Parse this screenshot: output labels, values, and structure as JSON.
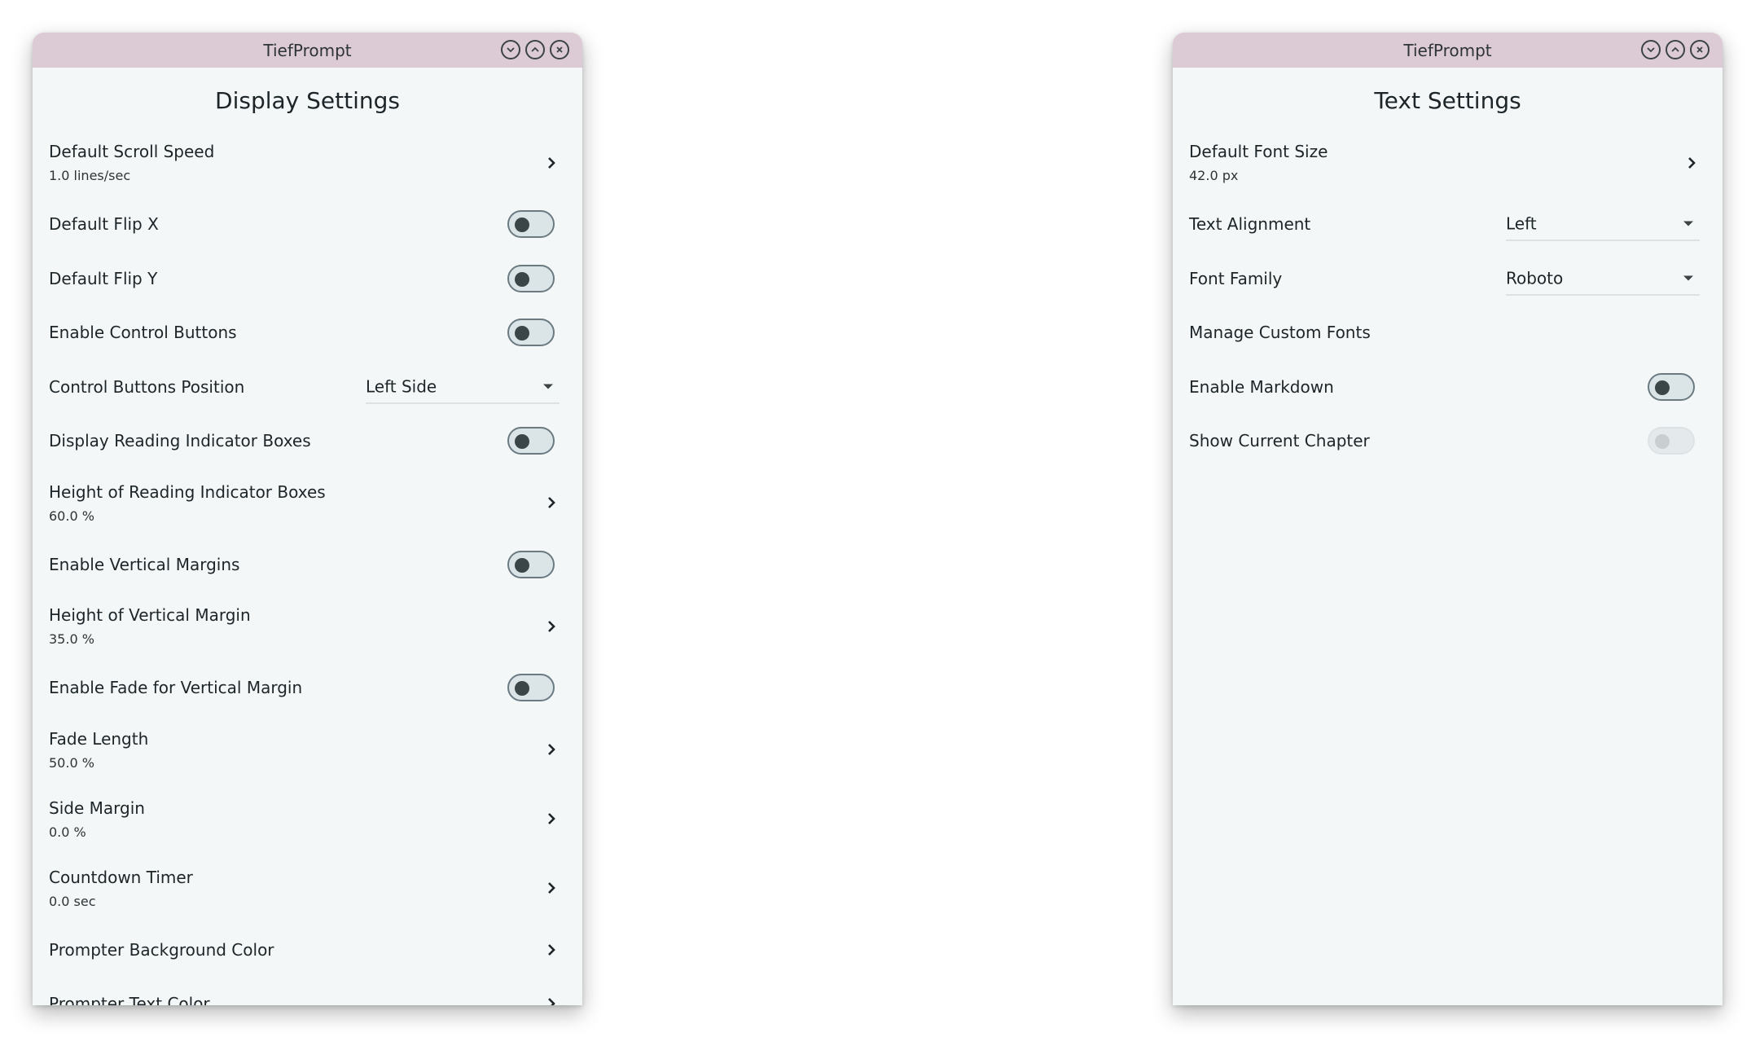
{
  "display_window": {
    "title": "TiefPrompt",
    "heading": "Display Settings",
    "items": [
      {
        "kind": "nav",
        "label": "Default Scroll Speed",
        "value": "1.0 lines/sec"
      },
      {
        "kind": "toggle",
        "label": "Default Flip X",
        "on": false
      },
      {
        "kind": "toggle",
        "label": "Default Flip Y",
        "on": false
      },
      {
        "kind": "toggle",
        "label": "Enable Control Buttons",
        "on": false
      },
      {
        "kind": "dropdown",
        "label": "Control Buttons Position",
        "selected": "Left Side"
      },
      {
        "kind": "toggle",
        "label": "Display Reading Indicator Boxes",
        "on": false
      },
      {
        "kind": "nav",
        "label": "Height of Reading Indicator Boxes",
        "value": "60.0 %"
      },
      {
        "kind": "toggle",
        "label": "Enable Vertical Margins",
        "on": false
      },
      {
        "kind": "nav",
        "label": "Height of Vertical Margin",
        "value": "35.0 %"
      },
      {
        "kind": "toggle",
        "label": "Enable Fade for Vertical Margin",
        "on": false
      },
      {
        "kind": "nav",
        "label": "Fade Length",
        "value": "50.0 %"
      },
      {
        "kind": "nav",
        "label": "Side Margin",
        "value": "0.0 %"
      },
      {
        "kind": "nav",
        "label": "Countdown Timer",
        "value": "0.0 sec"
      },
      {
        "kind": "navone",
        "label": "Prompter Background Color"
      },
      {
        "kind": "navone",
        "label": "Prompter Text Color"
      }
    ]
  },
  "text_window": {
    "title": "TiefPrompt",
    "heading": "Text Settings",
    "items": [
      {
        "kind": "nav",
        "label": "Default Font Size",
        "value": "42.0 px"
      },
      {
        "kind": "dropdown",
        "label": "Text Alignment",
        "selected": "Left"
      },
      {
        "kind": "dropdown",
        "label": "Font Family",
        "selected": "Roboto"
      },
      {
        "kind": "plain",
        "label": "Manage Custom Fonts"
      },
      {
        "kind": "toggle",
        "label": "Enable Markdown",
        "on": false
      },
      {
        "kind": "toggle-disabled",
        "label": "Show Current Chapter",
        "on": false
      }
    ]
  },
  "icons": {
    "minimize": "chevron-down-circle-icon",
    "maximize": "chevron-up-circle-icon",
    "close": "close-circle-icon",
    "nav": "chevron-right-icon"
  },
  "colors": {
    "titlebar": "#dccbd4",
    "panel": "#f3f7f8",
    "toggle_knob": "#3b4649"
  }
}
